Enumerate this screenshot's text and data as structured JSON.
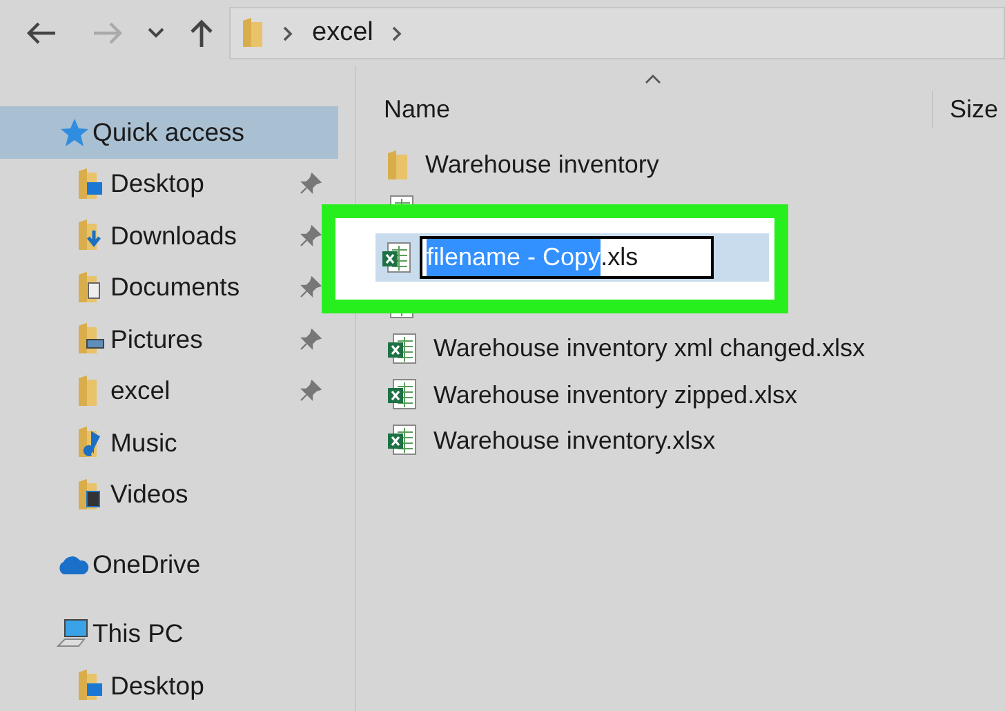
{
  "address_bar": {
    "path": [
      "excel"
    ]
  },
  "nav": {
    "forward_disabled": true
  },
  "sidebar": {
    "items": [
      {
        "kind": "quick",
        "label": "Quick access",
        "selected": true,
        "pinned": false
      },
      {
        "kind": "desktop",
        "label": "Desktop",
        "selected": false,
        "pinned": true
      },
      {
        "kind": "downloads",
        "label": "Downloads",
        "selected": false,
        "pinned": true
      },
      {
        "kind": "documents",
        "label": "Documents",
        "selected": false,
        "pinned": true
      },
      {
        "kind": "pictures",
        "label": "Pictures",
        "selected": false,
        "pinned": true
      },
      {
        "kind": "folder",
        "label": "excel",
        "selected": false,
        "pinned": true
      },
      {
        "kind": "music",
        "label": "Music",
        "selected": false,
        "pinned": false
      },
      {
        "kind": "videos",
        "label": "Videos",
        "selected": false,
        "pinned": false
      },
      {
        "kind": "onedrive",
        "label": "OneDrive",
        "selected": false,
        "pinned": false
      },
      {
        "kind": "pc",
        "label": "This PC",
        "selected": false,
        "pinned": false
      },
      {
        "kind": "desktop",
        "label": "Desktop",
        "selected": false,
        "pinned": false
      }
    ]
  },
  "columns": [
    "Name",
    "Size"
  ],
  "files": [
    {
      "kind": "folder",
      "name": "Warehouse inventory"
    },
    {
      "kind": "covered"
    },
    {
      "kind": "rename",
      "selected_text": "filename - Copy",
      "rest": ".xls"
    },
    {
      "kind": "covered"
    },
    {
      "kind": "excel",
      "name": "Warehouse inventory xml changed.xlsx"
    },
    {
      "kind": "excel",
      "name": "Warehouse inventory zipped.xlsx"
    },
    {
      "kind": "excel",
      "name": "Warehouse inventory.xlsx"
    }
  ]
}
